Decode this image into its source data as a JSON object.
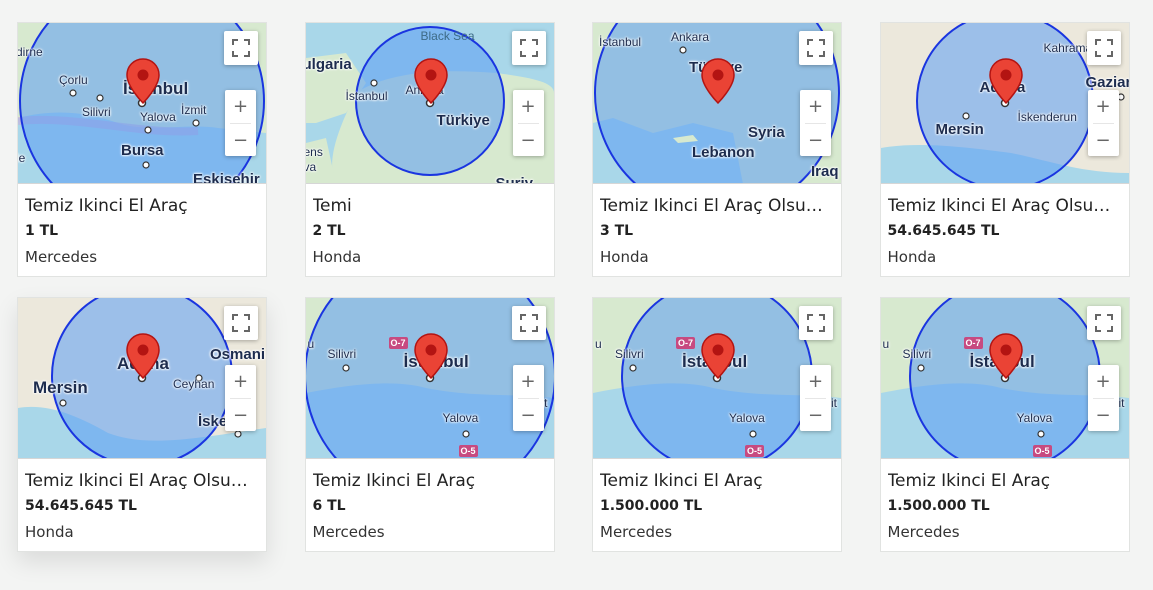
{
  "controls": {
    "fullscreen": "fullscreen-icon",
    "zoom_in": "+",
    "zoom_out": "−"
  },
  "listings": [
    {
      "title": "Temiz Ikinci El Araç",
      "price": "1 TL",
      "brand": "Mercedes",
      "map": {
        "land": "#d7e9cf",
        "labels": [
          "İstanbul",
          "Çorlu",
          "Silivri",
          "Yalova",
          "İzmit",
          "Bursa",
          "Eskişehir",
          "dirne",
          "le"
        ]
      }
    },
    {
      "title": "Temi",
      "price": "2 TL",
      "brand": "Honda",
      "map": {
        "land": "#d7e9cf",
        "labels": [
          "Black Sea",
          "ulgaria",
          "İstanbul",
          "Ankara",
          "Türkiye",
          "ens",
          "va",
          "Suriy"
        ]
      }
    },
    {
      "title": "Temiz Ikinci El Araç Olsun Diye Alındı",
      "price": "3 TL",
      "brand": "Honda",
      "map": {
        "land": "#d7e9cf",
        "labels": [
          "İstanbul",
          "Ankara",
          "Türkiye",
          "Syria",
          "Lebanon",
          "Iraq"
        ]
      }
    },
    {
      "title": "Temiz Ikinci El Araç Olsun Diye Alındı",
      "price": "54.645.645 TL",
      "brand": "Honda",
      "map": {
        "land": "#ece8dc",
        "labels": [
          "Kahraman",
          "Gaziant",
          "Adana",
          "Mersin",
          "İskenderun"
        ]
      }
    },
    {
      "title": "Temiz Ikinci El Araç Olsun Diye Alındı",
      "price": "54.645.645 TL",
      "brand": "Honda",
      "map": {
        "land": "#ece8dc",
        "labels": [
          "Osmani",
          "Adana",
          "Ceyhan",
          "Mersin",
          "İskende"
        ]
      }
    },
    {
      "title": "Temiz Ikinci El Araç",
      "price": "6 TL",
      "brand": "Mercedes",
      "map": {
        "land": "#d7e9cf",
        "labels": [
          "u",
          "Silivri",
          "O-7",
          "İstanbul",
          "Yalova",
          "O-5",
          "it"
        ]
      }
    },
    {
      "title": "Temiz Ikinci El Araç",
      "price": "1.500.000 TL",
      "brand": "Mercedes",
      "map": {
        "land": "#d7e9cf",
        "labels": [
          "u",
          "Silivri",
          "O-7",
          "İstanbul",
          "Yalova",
          "O-5",
          "mit"
        ]
      }
    },
    {
      "title": "Temiz Ikinci El Araç",
      "price": "1.500.000 TL",
      "brand": "Mercedes",
      "map": {
        "land": "#d7e9cf",
        "labels": [
          "u",
          "Silivri",
          "O-7",
          "İstanbul",
          "Yalova",
          "O-5",
          "mit"
        ]
      }
    }
  ]
}
